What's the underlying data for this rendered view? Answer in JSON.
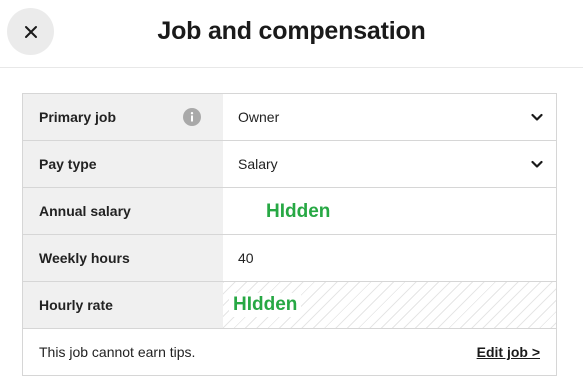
{
  "header": {
    "title": "Job and compensation",
    "close_icon": "close-icon"
  },
  "rows": [
    {
      "label": "Primary job",
      "value": "Owner",
      "icon": "info-icon",
      "control": "select"
    },
    {
      "label": "Pay type",
      "value": "Salary",
      "control": "select"
    },
    {
      "label": "Annual salary",
      "value": "HIdden",
      "control": "redacted"
    },
    {
      "label": "Weekly hours",
      "value": "40",
      "control": "input"
    },
    {
      "label": "Hourly rate",
      "value": "HIdden",
      "control": "redacted-readonly"
    }
  ],
  "footer": {
    "note": "This job cannot earn tips.",
    "edit_link": "Edit job >"
  },
  "colors": {
    "redaction_text": "#27a844",
    "label_background": "#f0f0f0",
    "border": "#d6d6d6"
  }
}
